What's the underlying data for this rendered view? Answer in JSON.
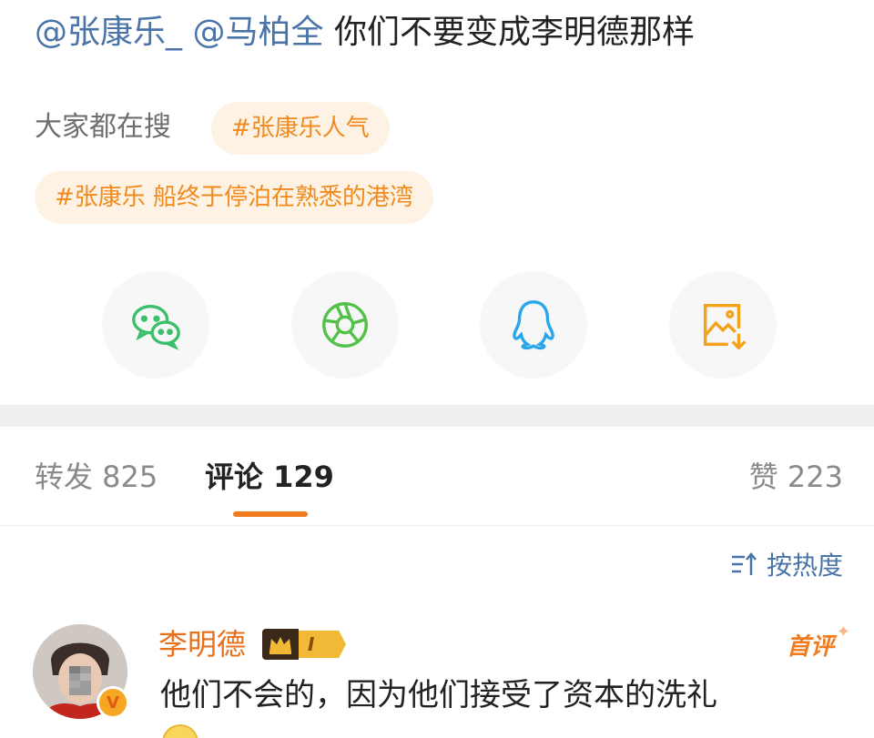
{
  "post": {
    "mention1": "@张康乐_",
    "mention2": "@马柏全",
    "text": "你们不要变成李明德那样"
  },
  "hot_search": {
    "label": "大家都在搜",
    "tags": [
      "#张康乐人气",
      "#张康乐 船终于停泊在熟悉的港湾"
    ]
  },
  "share": {
    "items": [
      {
        "icon": "wechat-icon",
        "color": "#3cbf6b"
      },
      {
        "icon": "moments-icon",
        "color": "#53c14a"
      },
      {
        "icon": "qq-icon",
        "color": "#2aa6e9"
      },
      {
        "icon": "save-image-icon",
        "color": "#f3a21a"
      }
    ]
  },
  "tabs": {
    "repost": "转发 825",
    "comment": "评论 129",
    "like": "赞 223"
  },
  "sort": {
    "label": "按热度"
  },
  "comment": {
    "username": "李明德",
    "level": "I",
    "badge": "首评",
    "verified": "V",
    "text": "他们不会的，因为他们接受了资本的洗礼"
  },
  "colors": {
    "accent": "#f07c1f",
    "link": "#4a74a8",
    "tag_bg": "#fdf2e4"
  }
}
